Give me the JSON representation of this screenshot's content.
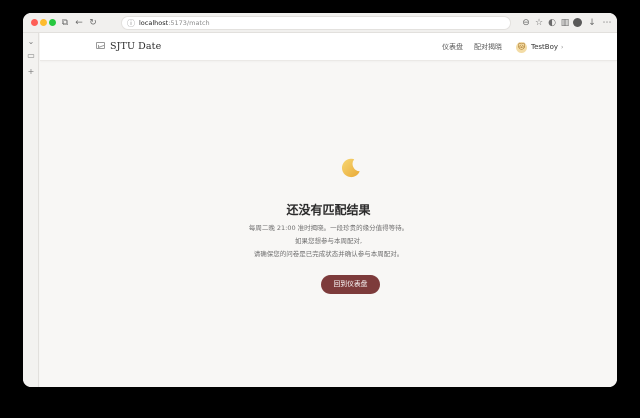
{
  "browser": {
    "url_host": "localhost",
    "url_path": ":5173/match"
  },
  "nav": {
    "brand": "SJTU Date",
    "links": [
      "仪表盘",
      "配对揭晓"
    ],
    "user": {
      "name": "TestBoy",
      "avatar_emoji": "🐱"
    }
  },
  "empty_state": {
    "icon": "crescent-moon-icon",
    "title": "还没有匹配结果",
    "lines": [
      "每周二晚 21:00 准时揭晓。一段珍贵的缘分值得等待。",
      "如果您想参与本周配对,",
      "请确保您的问卷是已完成状态并确认参与本周配对。"
    ],
    "cta_label": "回到仪表盘"
  },
  "colors": {
    "accent": "#7d3b3b",
    "page_bg": "#f8f7f5",
    "moon": "#f2c14e"
  }
}
